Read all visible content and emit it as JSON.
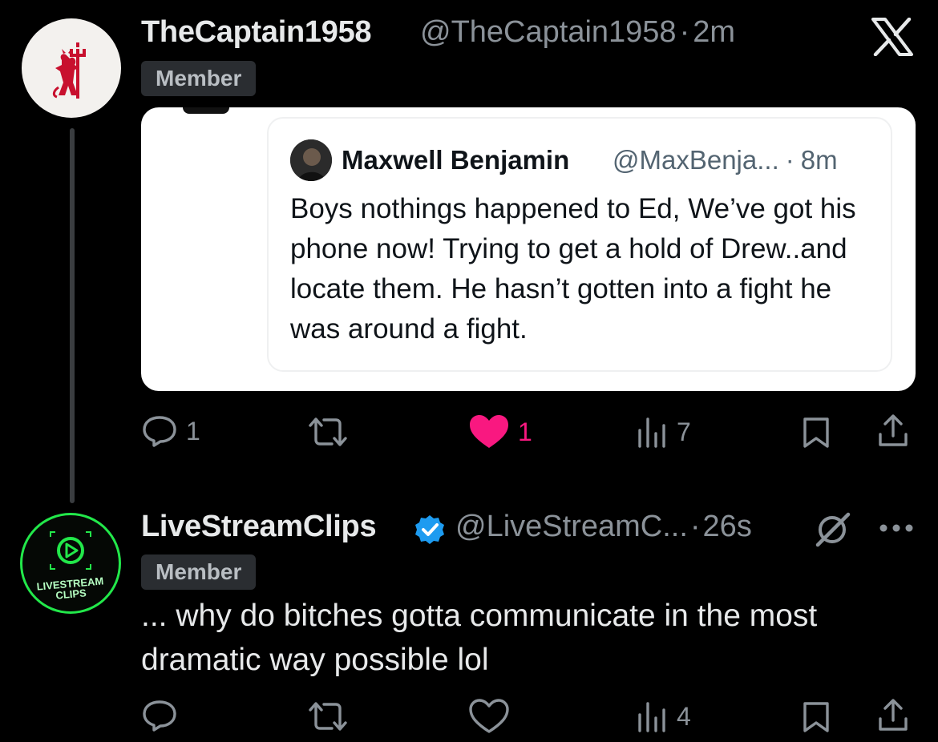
{
  "top_post": {
    "display_name": "TheCaptain1958",
    "handle": "@TheCaptain1958",
    "separator": "·",
    "time": "2m",
    "badge": "Member",
    "avatar_icon": "red-devil-crest",
    "source_icon": "x-logo-icon",
    "quote": {
      "display_name": "Maxwell Benjamin",
      "handle": "@MaxBenja...",
      "separator": "·",
      "time": "8m",
      "text": "Boys nothings happened to Ed, We’ve got his phone now! Trying to get a hold of Drew..and locate them. He hasn’t gotten into a fight he was around a fight."
    },
    "actions": {
      "replies": "1",
      "reposts": "",
      "likes": "1",
      "views": "7",
      "liked": true
    }
  },
  "reply_post": {
    "display_name": "LiveStreamClips",
    "verified": true,
    "handle": "@LiveStreamC...",
    "separator": "·",
    "time": "26s",
    "badge": "Member",
    "avatar_text": "LIVESTREAM CLIPS",
    "text": "... why do bitches gotta communicate in the most dramatic way possible lol",
    "actions": {
      "replies": "",
      "reposts": "",
      "likes": "",
      "views": "4",
      "liked": false
    }
  },
  "colors": {
    "background": "#000000",
    "like_active": "#f91880",
    "verified": "#1d9bf0",
    "muted": "#8b9299",
    "livestream_green": "#22e84a",
    "crest_red": "#c8102e"
  }
}
